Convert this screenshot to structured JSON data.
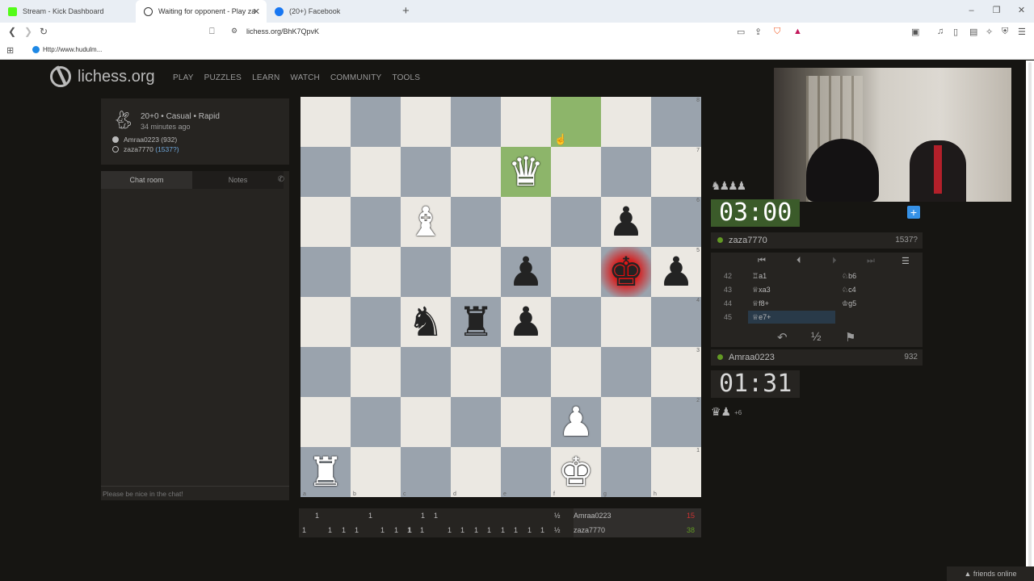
{
  "browser": {
    "tabs": [
      {
        "title": "Stream - Kick Dashboard",
        "color": "#53fc18"
      },
      {
        "title": "Waiting for opponent - Play zaza",
        "color": "#333333"
      },
      {
        "title": "(20+) Facebook",
        "color": "#1877f2"
      }
    ],
    "new_tab": "+",
    "url": "lichess.org/BhK7QpvK",
    "bookmark": "Http://www.hudulm..."
  },
  "site": {
    "logo": "lichess.org",
    "nav": [
      "PLAY",
      "PUZZLES",
      "LEARN",
      "WATCH",
      "COMMUNITY",
      "TOOLS"
    ]
  },
  "game_info": {
    "summary": "20+0 • Casual • Rapid",
    "time_ago": "34 minutes ago",
    "black_player": "Amraa0223 (932)",
    "white_player_name": "zaza7770",
    "white_player_rating": "(1537?)"
  },
  "chat": {
    "tab_chat": "Chat room",
    "tab_notes": "Notes",
    "placeholder": "Please be nice in the chat!"
  },
  "board": {
    "ranks": [
      "8",
      "7",
      "6",
      "5",
      "4",
      "3",
      "2",
      "1"
    ],
    "files": [
      "a",
      "b",
      "c",
      "d",
      "e",
      "f",
      "g",
      "h"
    ],
    "pieces": {
      "e7": "wQ",
      "c6": "wB",
      "g6": "bP",
      "e5": "bP",
      "g5": "bK",
      "h5": "bP",
      "c4": "bN",
      "d4": "bR",
      "e4": "bP",
      "f2": "wP",
      "a1": "wR",
      "f1": "wK"
    },
    "highlight": [
      "f8",
      "e7"
    ],
    "check": "g5"
  },
  "panel": {
    "top_material": "♞♟♟♟",
    "top_clock": "03:00",
    "top_player": "zaza7770",
    "top_rating": "1537?",
    "moves": [
      {
        "n": "42",
        "w": "♖a1",
        "b": "♘b6"
      },
      {
        "n": "43",
        "w": "♕xa3",
        "b": "♘c4"
      },
      {
        "n": "44",
        "w": "♕f8+",
        "b": "♔g5"
      },
      {
        "n": "45",
        "w": "♕e7+",
        "b": ""
      }
    ],
    "bottom_player": "Amraa0223",
    "bottom_rating": "932",
    "bottom_clock": "01:31",
    "bottom_material": "♛♟",
    "bottom_material_diff": "+6",
    "draw_label": "½"
  },
  "crosstable": {
    "rows": [
      {
        "scores": [
          "1",
          "1",
          "1",
          "1"
        ],
        "half": "½",
        "player": "Amraa0223",
        "total": "15",
        "total_color": "#cc3333"
      },
      {
        "scores": [
          "1",
          "1",
          "1",
          "1",
          "1",
          "1",
          "1",
          "1",
          "1",
          "1",
          "1",
          "1",
          "1",
          "1",
          "1",
          "1",
          "1"
        ],
        "half": "½",
        "player": "zaza7770",
        "total": "38",
        "total_color": "#629924"
      }
    ]
  },
  "friends": "▲ friends online"
}
